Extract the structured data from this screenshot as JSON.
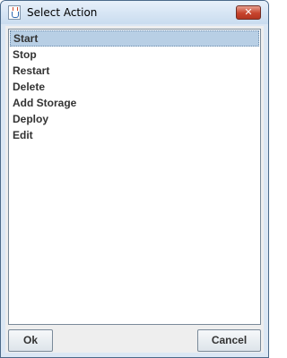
{
  "window": {
    "title": "Select Action",
    "close_label": "✕"
  },
  "actions": {
    "selected": "Start",
    "items": [
      {
        "label": "Start"
      },
      {
        "label": "Stop"
      },
      {
        "label": "Restart"
      },
      {
        "label": "Delete"
      },
      {
        "label": "Add Storage"
      },
      {
        "label": "Deploy"
      },
      {
        "label": "Edit"
      }
    ]
  },
  "buttons": {
    "ok": "Ok",
    "cancel": "Cancel"
  },
  "icons": {
    "app": "java-cup-icon",
    "close": "close-icon"
  },
  "colors": {
    "selection": "#b8cfe5",
    "close_button": "#c7442d"
  }
}
